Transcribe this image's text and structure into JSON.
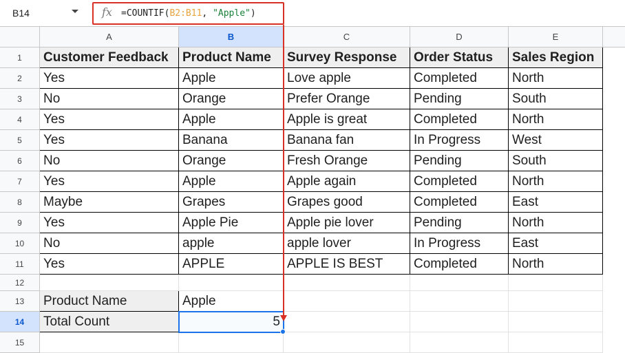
{
  "name_box": "B14",
  "formula_bar": {
    "icon": "fx-icon",
    "prefix": "=COUNTIF(",
    "range": "B2:B11",
    "separator": ", ",
    "criterion": "\"Apple\"",
    "suffix": ")"
  },
  "column_headers": [
    "A",
    "B",
    "C",
    "D",
    "E"
  ],
  "row_headers": [
    "1",
    "2",
    "3",
    "4",
    "5",
    "6",
    "7",
    "8",
    "9",
    "10",
    "11",
    "12",
    "13",
    "14",
    "15"
  ],
  "table": {
    "headers": [
      "Customer Feedback",
      "Product Name",
      "Survey Response",
      "Order Status",
      "Sales Region"
    ],
    "rows": [
      [
        "Yes",
        "Apple",
        "Love apple",
        "Completed",
        "North"
      ],
      [
        "No",
        "Orange",
        "Prefer Orange",
        "Pending",
        "South"
      ],
      [
        "Yes",
        "Apple",
        "Apple is great",
        "Completed",
        "North"
      ],
      [
        "Yes",
        "Banana",
        "Banana fan",
        "In Progress",
        "West"
      ],
      [
        "No",
        "Orange",
        "Fresh Orange",
        "Pending",
        "South"
      ],
      [
        "Yes",
        "Apple",
        "Apple again",
        "Completed",
        "North"
      ],
      [
        "Maybe",
        "Grapes",
        "Grapes good",
        "Completed",
        "East"
      ],
      [
        "Yes",
        "Apple Pie",
        "Apple pie lover",
        "Pending",
        "North"
      ],
      [
        "No",
        "apple",
        "apple lover",
        "In Progress",
        "East"
      ],
      [
        "Yes",
        "APPLE",
        "APPLE IS BEST",
        "Completed",
        "North"
      ]
    ]
  },
  "summary": {
    "product_label": "Product Name",
    "product_value": "Apple",
    "count_label": "Total Count",
    "count_value": "5"
  },
  "colors": {
    "highlight_annotation": "#d93025",
    "selection": "#1a73e8",
    "range_ref": "#e8a33d",
    "string_literal": "#188038"
  }
}
